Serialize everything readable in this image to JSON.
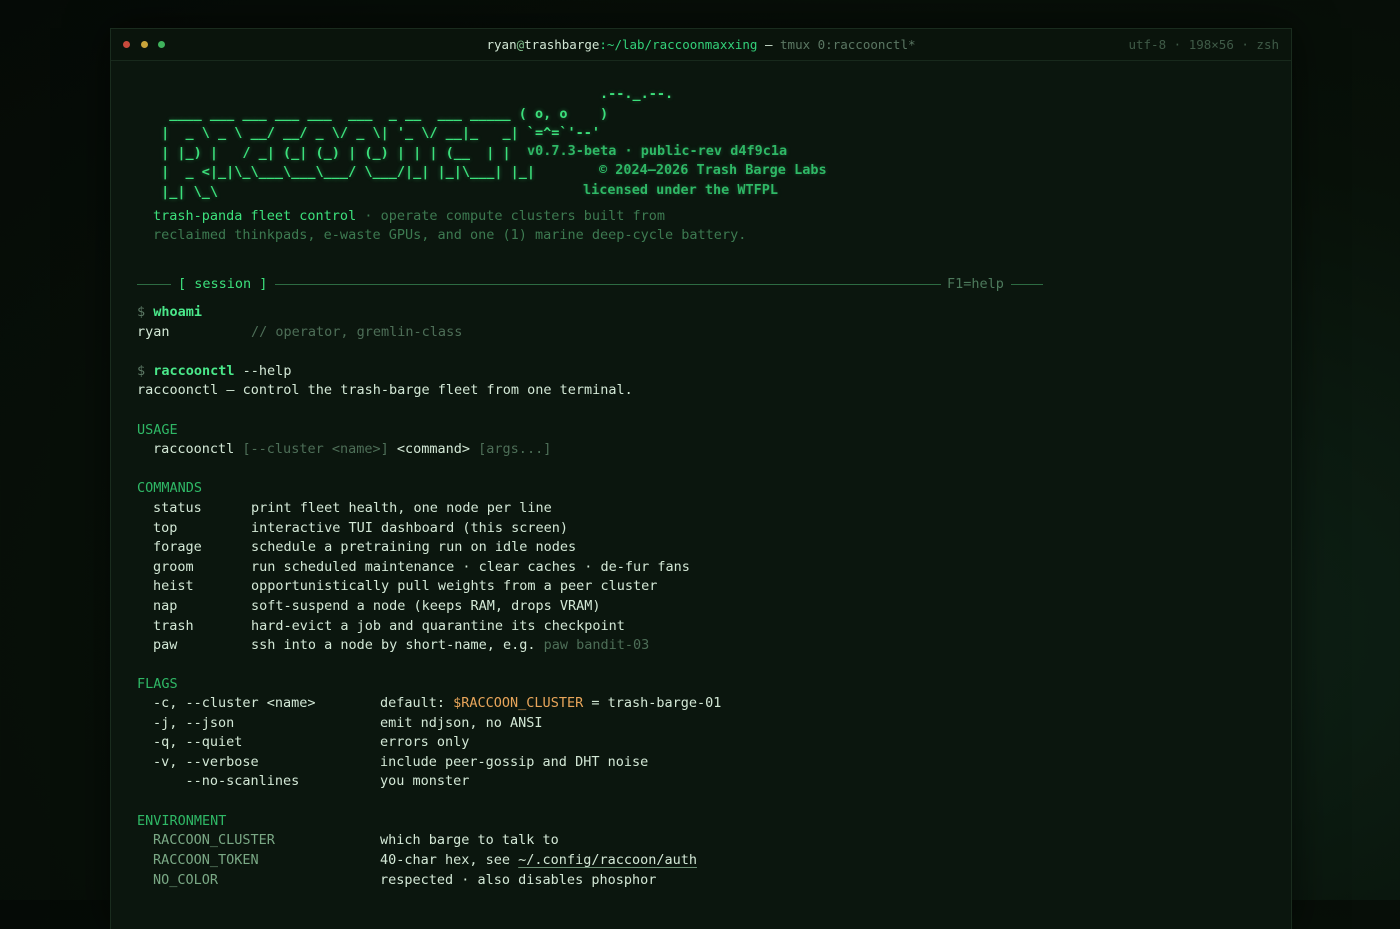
{
  "window": {
    "title_user": "ryan",
    "title_at": "@",
    "title_host": "trashbarge",
    "title_path": ":~/lab/raccoonmaxxing",
    "title_sep": " — ",
    "title_tmux": "tmux 0:raccoonctl*",
    "status_right": "utf-8 · 198×56 · zsh"
  },
  "banner": {
    "ascii": "                                                       .--._.--.\n  ____ ___ ___ ___ ___  ___  _ __  ___ _____ ( o, o    )\n |  _ \\ _ \\ __/ __/ _ \\/ _ \\| '_ \\/ __|_   _| `=^=`'--'\n | |_) |   / _| (_| (_) | (_) | | | (__  | |   \n |  _ <|_|\\_\\___\\___\\___/ \\___/|_| |_|\\___| |_|   \n |_| \\_\\",
    "version": "v0.7.3-beta · public-rev d4f9c1a",
    "copyright": "© 2024–2026 Trash Barge Labs",
    "license": "licensed under the WTFPL",
    "tagline_name": "trash-panda fleet control",
    "tagline_rest": " · operate compute clusters built from",
    "tagline_line2": "reclaimed thinkpads, e-waste GPUs, and one (1) marine deep-cycle battery."
  },
  "session": {
    "label": "[ session ]",
    "help": "F1=help"
  },
  "cmd1": {
    "prompt": "$ ",
    "command": "whoami",
    "out_user": "ryan",
    "out_comment": "// operator, gremlin-class"
  },
  "cmd2": {
    "prompt": "$ ",
    "command": "raccoonctl",
    "args": " --help",
    "out": "raccoonctl — control the trash-barge fleet from one terminal."
  },
  "usage": {
    "heading": "USAGE",
    "bin": "raccoonctl",
    "opt": "[--cluster <name>]",
    "cmd": "<command>",
    "args": "[args...]"
  },
  "commands": {
    "heading": "COMMANDS",
    "items": [
      {
        "name": "status",
        "desc": "print fleet health, one node per line",
        "extra": ""
      },
      {
        "name": "top",
        "desc": "interactive TUI dashboard (this screen)",
        "extra": ""
      },
      {
        "name": "forage",
        "desc": "schedule a pretraining run on idle nodes",
        "extra": ""
      },
      {
        "name": "groom",
        "desc": "run scheduled maintenance · clear caches · de-fur fans",
        "extra": ""
      },
      {
        "name": "heist",
        "desc": "opportunistically pull weights from a peer cluster",
        "extra": ""
      },
      {
        "name": "nap",
        "desc": "soft-suspend a node (keeps RAM, drops VRAM)",
        "extra": ""
      },
      {
        "name": "trash",
        "desc": "hard-evict a job and quarantine its checkpoint",
        "extra": ""
      },
      {
        "name": "paw",
        "desc": "ssh into a node by short-name, e.g. ",
        "extra": "paw bandit-03"
      }
    ]
  },
  "flags": {
    "heading": "FLAGS",
    "items": [
      {
        "flag": "-c, --cluster <name>",
        "desc": "default: ",
        "var": "$RACCOON_CLUSTER",
        "tail": " = trash-barge-01"
      },
      {
        "flag": "-j, --json",
        "desc": "emit ndjson, no ANSI",
        "var": "",
        "tail": ""
      },
      {
        "flag": "-q, --quiet",
        "desc": "errors only",
        "var": "",
        "tail": ""
      },
      {
        "flag": "-v, --verbose",
        "desc": "include peer-gossip and DHT noise",
        "var": "",
        "tail": ""
      },
      {
        "flag": "    --no-scanlines",
        "desc": "you monster",
        "var": "",
        "tail": ""
      }
    ]
  },
  "environment": {
    "heading": "ENVIRONMENT",
    "items": [
      {
        "name": "RACCOON_CLUSTER",
        "desc": "which barge to talk to",
        "link": ""
      },
      {
        "name": "RACCOON_TOKEN",
        "desc": "40-char hex, see ",
        "link": "~/.config/raccoon/auth"
      },
      {
        "name": "NO_COLOR",
        "desc": "respected · also disables phosphor",
        "link": ""
      }
    ]
  }
}
